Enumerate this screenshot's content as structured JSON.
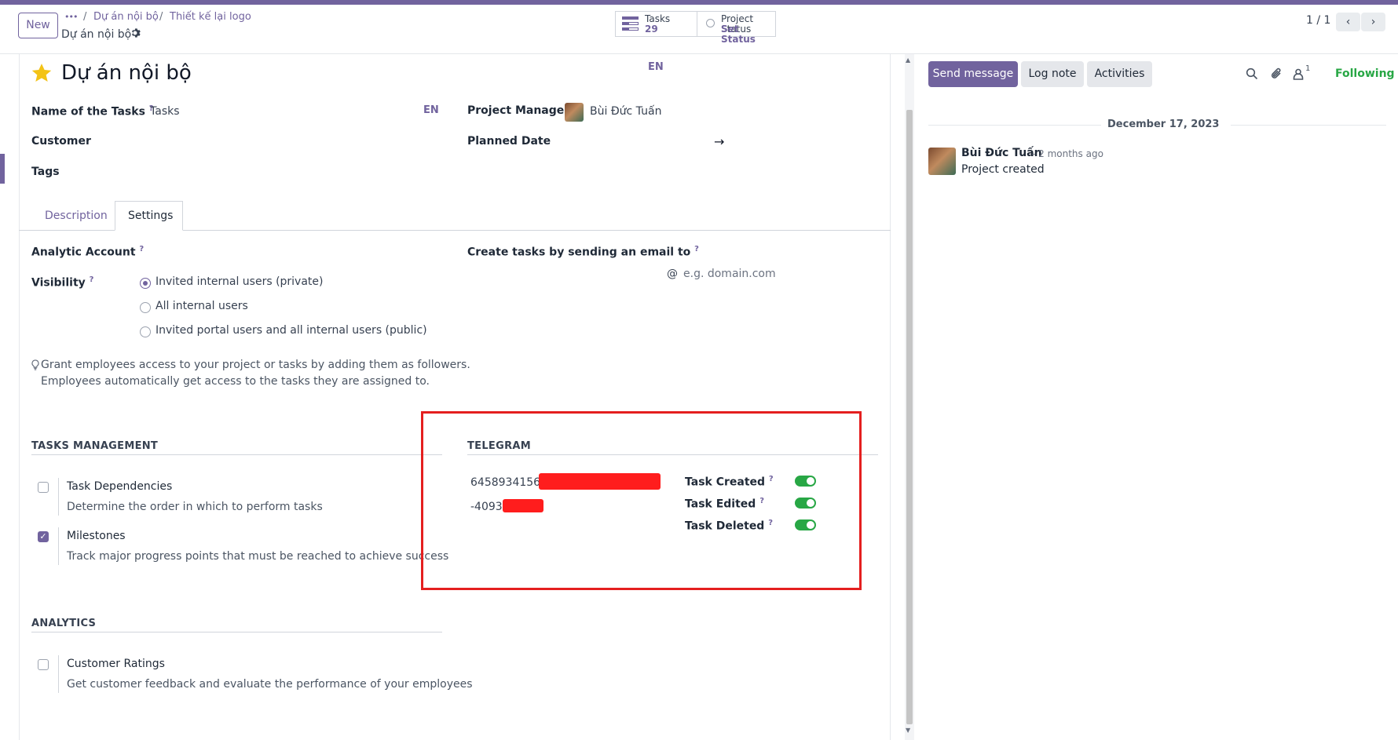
{
  "control_panel": {
    "new_label": "New",
    "breadcrumb": {
      "ellipsis": "•••",
      "items": [
        "Dự án nội bộ",
        "Thiết kế lại logo"
      ],
      "separator": "/"
    },
    "current_record": "Dự án nội bộ",
    "smart_buttons": [
      {
        "label": "Tasks",
        "value": "29",
        "icon": "tasks-icon"
      },
      {
        "label": "Project Status",
        "value": "Set Status",
        "icon": "status-circle-icon"
      }
    ],
    "pager": {
      "text": "1 / 1"
    }
  },
  "form": {
    "title": "Dự án nội bộ",
    "title_lang": "EN",
    "fields_left": {
      "name_of_tasks_label": "Name of the Tasks",
      "name_of_tasks_value": "Tasks",
      "name_of_tasks_lang": "EN",
      "customer_label": "Customer",
      "tags_label": "Tags"
    },
    "fields_right": {
      "project_manager_label": "Project Manager",
      "project_manager_value": "Bùi Đức Tuấn",
      "planned_date_label": "Planned Date",
      "planned_date_arrow": "→"
    },
    "help_mark": "?",
    "tabs": [
      {
        "label": "Description",
        "active": false
      },
      {
        "label": "Settings",
        "active": true
      }
    ],
    "settings": {
      "analytic_account_label": "Analytic Account",
      "create_tasks_label": "Create tasks by sending an email to",
      "email_at": "@",
      "email_placeholder": "e.g. domain.com",
      "visibility_label": "Visibility",
      "visibility_options": [
        {
          "label": "Invited internal users (private)",
          "selected": true
        },
        {
          "label": "All internal users",
          "selected": false
        },
        {
          "label": "Invited portal users and all internal users (public)",
          "selected": false
        }
      ],
      "hint_line1": "Grant employees access to your project or tasks by adding them as followers.",
      "hint_line2": "Employees automatically get access to the tasks they are assigned to."
    },
    "tasks_management": {
      "heading": "TASKS MANAGEMENT",
      "items": [
        {
          "title": "Task Dependencies",
          "desc": "Determine the order in which to perform tasks",
          "checked": false
        },
        {
          "title": "Milestones",
          "desc": "Track major progress points that must be reached to achieve success",
          "checked": true
        }
      ]
    },
    "telegram": {
      "heading": "TELEGRAM",
      "bot_token_visible": "6458934156:AA",
      "chat_id_visible": "-40932",
      "toggles": [
        {
          "label": "Task Created",
          "on": true
        },
        {
          "label": "Task Edited",
          "on": true
        },
        {
          "label": "Task Deleted",
          "on": true
        }
      ]
    },
    "analytics": {
      "heading": "ANALYTICS",
      "items": [
        {
          "title": "Customer Ratings",
          "desc": "Get customer feedback and evaluate the performance of your employees",
          "checked": false
        }
      ]
    }
  },
  "chatter": {
    "send_message_label": "Send message",
    "log_note_label": "Log note",
    "activities_label": "Activities",
    "followers_count": "1",
    "following_label": "Following",
    "date_separator": "December 17, 2023",
    "messages": [
      {
        "author": "Bùi Đức Tuấn",
        "time": "- 2 months ago",
        "body": "Project created"
      }
    ]
  },
  "colors": {
    "brand": "#71639e",
    "success": "#28a745",
    "highlight_box": "#e41f1f"
  }
}
